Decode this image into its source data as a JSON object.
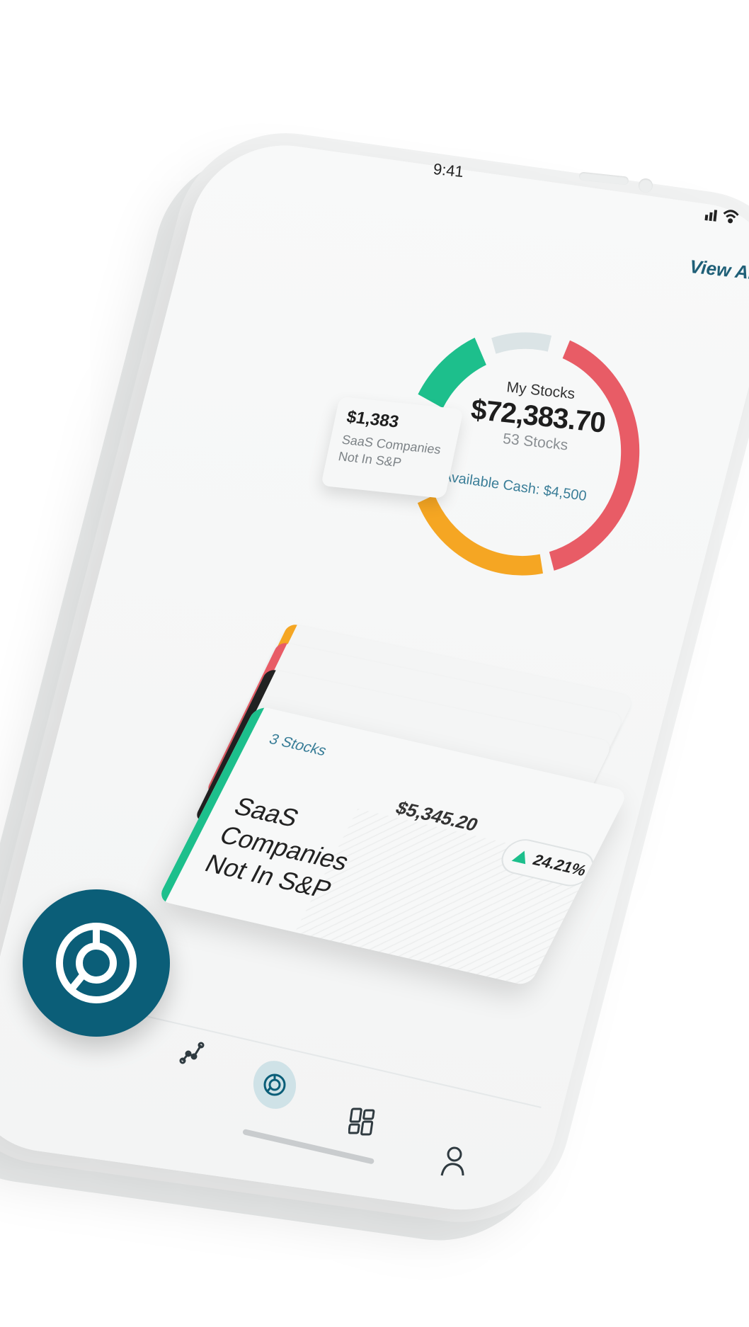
{
  "status": {
    "time": "9:41",
    "signal_icon": "signal-icon",
    "wifi_icon": "wifi-icon"
  },
  "header": {
    "view_all": "View All"
  },
  "portfolio": {
    "title": "My Stocks",
    "value": "$72,383.70",
    "count": "53 Stocks",
    "available_cash": "Available Cash: $4,500"
  },
  "tooltip": {
    "value": "$1,383",
    "label_line1": "SaaS Companies",
    "label_line2": "Not In S&P"
  },
  "donut": {
    "segments": [
      {
        "color": "#e85c66",
        "share": 0.41
      },
      {
        "color": "#f5a623",
        "share": 0.22
      },
      {
        "color": "#1dbf8c",
        "share": 0.12
      },
      {
        "color": "#dbe4e6",
        "share": 0.1
      }
    ]
  },
  "stack_colors": [
    "#f5a623",
    "#e85c66",
    "#222222",
    "#1dbf8c"
  ],
  "card": {
    "count": "3 Stocks",
    "amount": "$5,345.20",
    "title_line1": "SaaS Companies",
    "title_line2": "Not In S&P",
    "change": "24.21%",
    "change_color": "#1dbf8c"
  },
  "nav": {
    "items": [
      {
        "icon": "chart-line-icon"
      },
      {
        "icon": "portfolio-donut-icon",
        "active": true
      },
      {
        "icon": "grid-icon"
      },
      {
        "icon": "user-icon"
      }
    ]
  },
  "badge": {
    "icon": "portfolio-donut-icon",
    "color": "#0b5e78"
  }
}
